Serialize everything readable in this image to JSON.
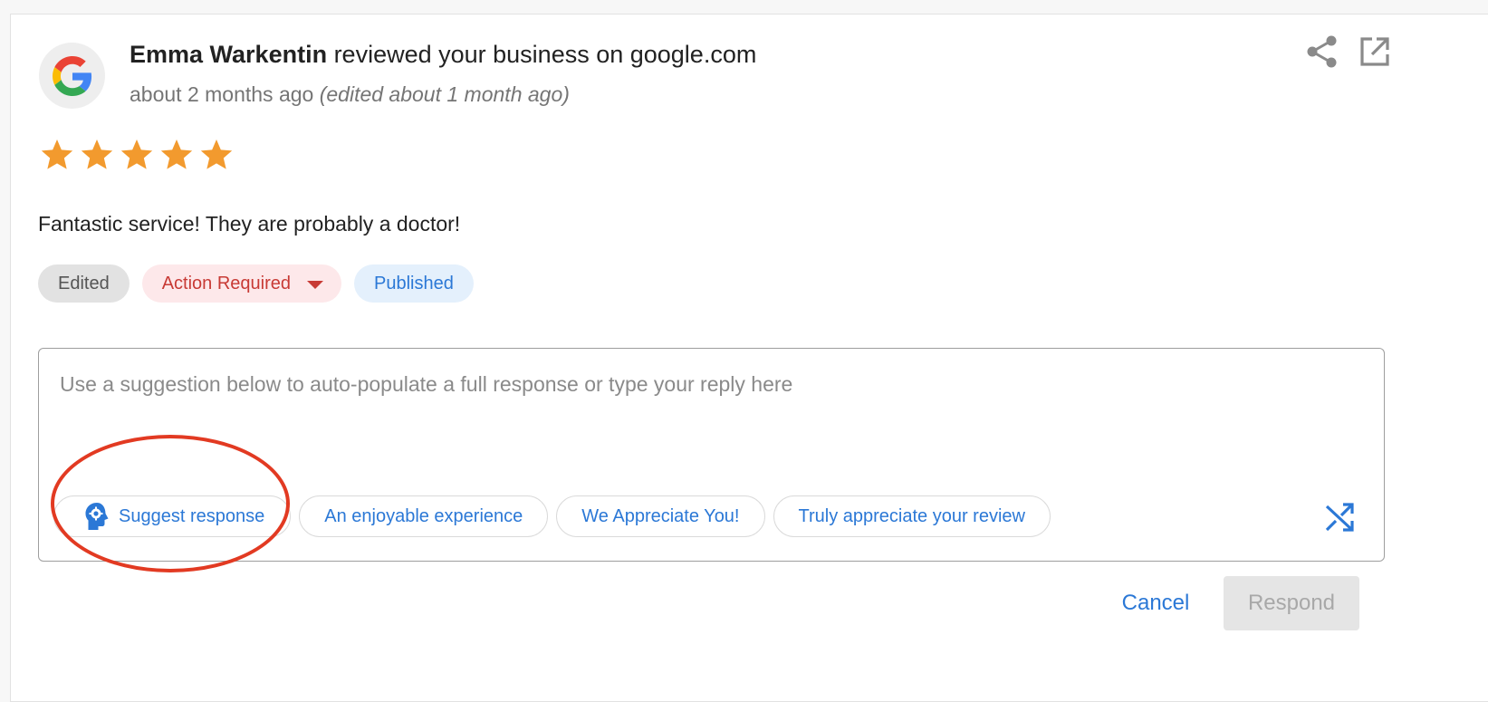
{
  "review": {
    "author": "Emma Warkentin",
    "action_text": " reviewed your business on google.com",
    "time": "about 2 months ago",
    "edited_note": "(edited about 1 month ago)",
    "rating": 5,
    "max_rating": 5,
    "text": "Fantastic service! They are probably a doctor!"
  },
  "tags": {
    "edited": "Edited",
    "action_required": "Action Required",
    "published": "Published"
  },
  "reply": {
    "placeholder": "Use a suggestion below to auto-populate a full response or type your reply here",
    "value": ""
  },
  "suggestions": {
    "suggest_response": "Suggest response",
    "chips": [
      "An enjoyable experience",
      "We Appreciate You!",
      "Truly appreciate your review"
    ]
  },
  "buttons": {
    "cancel": "Cancel",
    "respond": "Respond"
  },
  "icons": {
    "source": "google-logo-icon",
    "share": "share-icon",
    "open": "open-in-new-icon",
    "star": "star-icon",
    "brain": "brain-gear-icon",
    "shuffle": "shuffle-icon"
  },
  "colors": {
    "accent": "#2b78d6",
    "star": "#f29a2e",
    "danger": "#c83a35",
    "highlight": "#e23a22"
  }
}
